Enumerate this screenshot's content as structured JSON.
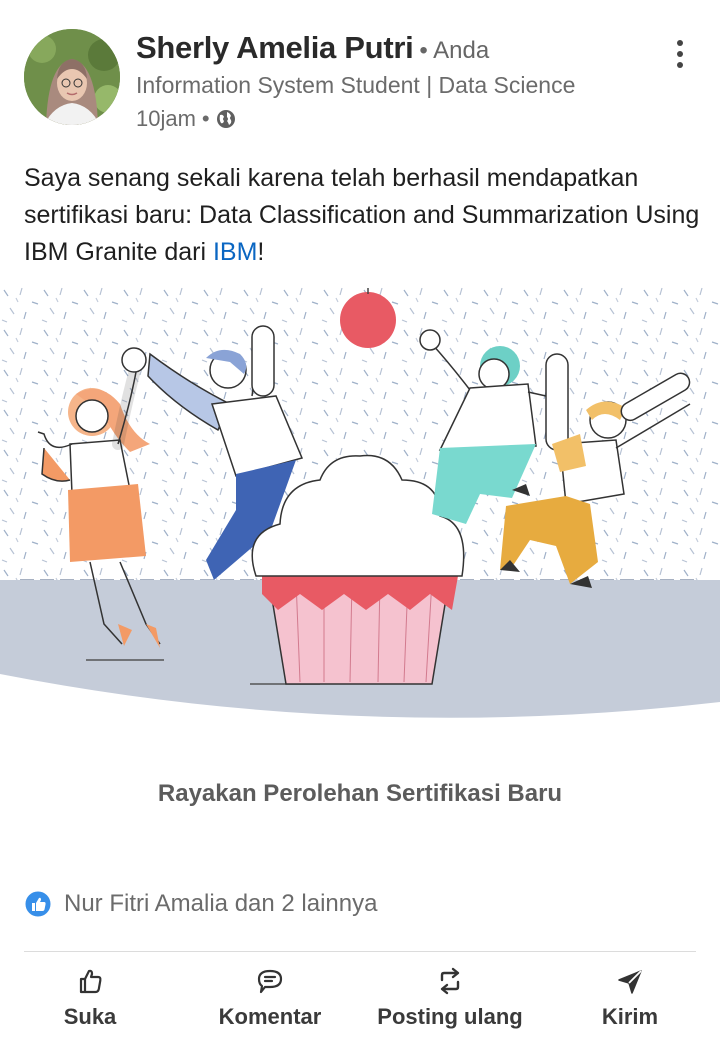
{
  "post": {
    "author": {
      "name": "Sherly Amelia Putri",
      "degree": "• Anda",
      "headline": "Information System Student | Data Science",
      "avatar_icon": "profile-photo"
    },
    "meta": {
      "time": "10jam",
      "separator": "•",
      "visibility_icon": "globe-icon"
    },
    "text": {
      "part1": "Saya senang sekali karena telah berhasil mendapatkan sertifikasi baru: Data Classification and Summarization Using IBM Granite dari ",
      "mention": "IBM",
      "part2": "!"
    },
    "image_caption": "Rayakan Perolehan Sertifikasi Baru",
    "reactions": {
      "text": "Nur Fitri Amalia dan 2 lainnya",
      "icon": "like-reaction-icon"
    }
  },
  "actions": {
    "like": "Suka",
    "comment": "Komentar",
    "repost": "Posting ulang",
    "send": "Kirim"
  },
  "colors": {
    "mention": "#0a66c2",
    "like_blue": "#378fe9",
    "floor": "#c5ccd9",
    "balloon": "#e85a64"
  }
}
